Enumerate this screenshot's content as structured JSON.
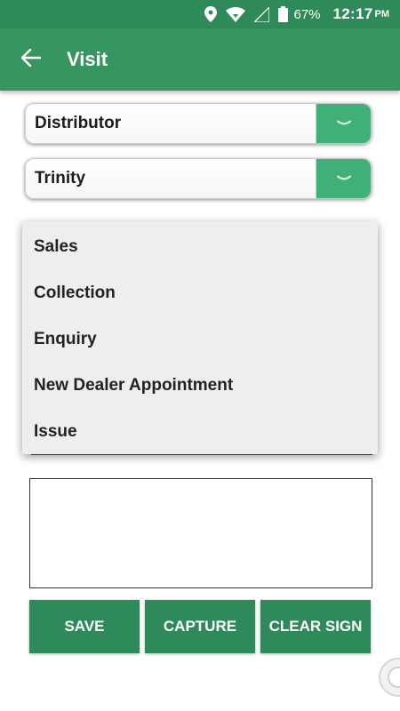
{
  "status_bar": {
    "battery": "67%",
    "time": "12:17",
    "ampm": "PM",
    "icons": [
      "location-icon",
      "wifi-icon",
      "signal-icon",
      "battery-icon"
    ]
  },
  "app_bar": {
    "title": "Visit",
    "back_icon": "back-arrow-icon",
    "color": "#37955f"
  },
  "form": {
    "distributor": {
      "value": "Distributor"
    },
    "dealer": {
      "value": "Trinity"
    }
  },
  "dropdown": {
    "options": [
      "Sales",
      "Collection",
      "Enquiry",
      "New Dealer Appointment",
      "Issue"
    ]
  },
  "actions": {
    "save": "SAVE",
    "capture": "CAPTURE",
    "clear_sign": "CLEAR SIGN"
  },
  "colors": {
    "accent": "#3fb178",
    "button": "#2f8a5b",
    "status_bar": "#2f8a59"
  }
}
